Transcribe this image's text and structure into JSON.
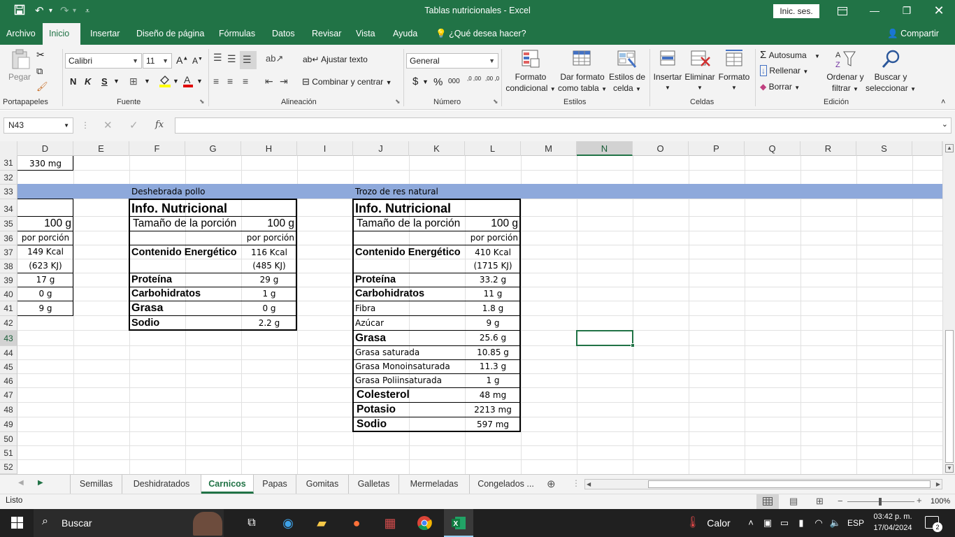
{
  "window": {
    "title": "Tablas nutricionales  -  Excel",
    "signin": "Inic. ses."
  },
  "menu": {
    "tabs": [
      "Archivo",
      "Inicio",
      "Insertar",
      "Diseño de página",
      "Fórmulas",
      "Datos",
      "Revisar",
      "Vista",
      "Ayuda"
    ],
    "active": "Inicio",
    "tell_me": "¿Qué desea hacer?",
    "share": "Compartir"
  },
  "ribbon": {
    "paste": "Pegar",
    "font_name": "Calibri",
    "font_size": "11",
    "bold": "N",
    "italic": "K",
    "underline": "S",
    "wrap_text": "Ajustar texto",
    "merge_center": "Combinar y centrar",
    "number_format": "General",
    "currency": "$",
    "percent": "%",
    "thousands": "000",
    "inc_decimals": ",0 ,00",
    "dec_decimals": ",00 ,0",
    "cond_format_1": "Formato",
    "cond_format_2": "condicional",
    "format_table_1": "Dar formato",
    "format_table_2": "como tabla",
    "cell_styles_1": "Estilos de",
    "cell_styles_2": "celda",
    "insert": "Insertar",
    "delete": "Eliminar",
    "format": "Formato",
    "autosum": "Autosuma",
    "fill": "Rellenar",
    "clear": "Borrar",
    "sort_1": "Ordenar y",
    "sort_2": "filtrar",
    "find_1": "Buscar y",
    "find_2": "seleccionar",
    "groups": {
      "clipboard": "Portapapeles",
      "font": "Fuente",
      "alignment": "Alineación",
      "number": "Número",
      "styles": "Estilos",
      "cells": "Celdas",
      "editing": "Edición"
    }
  },
  "formula_bar": {
    "name_box": "N43",
    "fx": "fx",
    "value": ""
  },
  "columns": [
    "D",
    "E",
    "F",
    "G",
    "H",
    "I",
    "J",
    "K",
    "L",
    "M",
    "N",
    "O",
    "P",
    "Q",
    "R",
    "S"
  ],
  "selected_column": "N",
  "rows": [
    "31",
    "32",
    "33",
    "34",
    "35",
    "36",
    "37",
    "38",
    "39",
    "40",
    "41",
    "42",
    "43",
    "44",
    "45",
    "46",
    "47",
    "48",
    "49",
    "50",
    "51",
    "52"
  ],
  "selected_row": "43",
  "cells": {
    "d31": "330 mg",
    "f33": "Deshebrada pollo",
    "j33": "Trozo de res natural",
    "d35": "100 g",
    "d36": "por porción",
    "d37": "149 Kcal",
    "d38": "(623 KJ)",
    "d39": "17 g",
    "d40": "0 g",
    "d41": "9 g",
    "pollo": {
      "title": "Info. Nutricional",
      "portion_label": "Tamaño de la porción",
      "portion_value": "100 g",
      "per_portion": "por porción",
      "energy_label": "Contenido Energético",
      "energy_kcal": "116 Kcal",
      "energy_kj": "(485 KJ)",
      "protein_label": "Proteína",
      "protein_value": "29 g",
      "carbs_label": "Carbohidratos",
      "carbs_value": "1 g",
      "fat_label": "Grasa",
      "fat_value": "0 g",
      "sodium_label": "Sodio",
      "sodium_value": "2.2 g"
    },
    "res": {
      "title": "Info. Nutricional",
      "portion_label": "Tamaño de la porción",
      "portion_value": "100 g",
      "per_portion": "por porción",
      "energy_label": "Contenido Energético",
      "energy_kcal": "410 Kcal",
      "energy_kj": "(1715 KJ)",
      "protein_label": "Proteína",
      "protein_value": "33.2 g",
      "carbs_label": "Carbohidratos",
      "carbs_value": "11 g",
      "fiber_label": "Fibra",
      "fiber_value": "1.8 g",
      "sugar_label": "Azúcar",
      "sugar_value": "9 g",
      "fat_label": "Grasa",
      "fat_value": "25.6 g",
      "satfat_label": "Grasa saturada",
      "satfat_value": "10.85 g",
      "monofat_label": "Grasa Monoinsaturada",
      "monofat_value": "11.3 g",
      "polyfat_label": "Grasa Poliinsaturada",
      "polyfat_value": "1 g",
      "chol_label": "Colesterol",
      "chol_value": "48 mg",
      "potassium_label": "Potasio",
      "potassium_value": "2213 mg",
      "sodium_label": "Sodio",
      "sodium_value": "597 mg"
    }
  },
  "sheet_tabs": [
    "Semillas",
    "Deshidratados",
    "Carnicos",
    "Papas",
    "Gomitas",
    "Galletas",
    "Mermeladas",
    "Congelados ..."
  ],
  "active_sheet": "Carnicos",
  "status": {
    "ready": "Listo",
    "zoom": "100%"
  },
  "taskbar": {
    "search": "Buscar",
    "weather": "Calor",
    "lang": "ESP",
    "time": "03:42 p. m.",
    "date": "17/04/2024",
    "notifications": "2"
  },
  "colors": {
    "excel_green": "#217346",
    "band_blue": "#8ea9db",
    "taskbar": "#202020"
  }
}
